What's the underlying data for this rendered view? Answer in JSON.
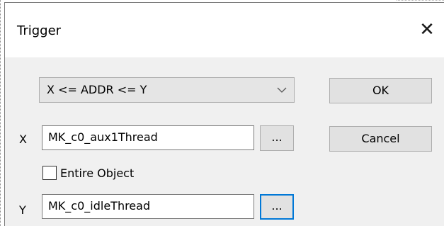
{
  "dialog": {
    "title": "Trigger",
    "close_glyph": "✕",
    "close_icon": "close-icon"
  },
  "condition": {
    "selected": "X <= ADDR <= Y",
    "arrow_icon": "chevron-down-icon"
  },
  "buttons": {
    "ok": "OK",
    "cancel": "Cancel",
    "browse": "..."
  },
  "fields": {
    "x_label": "X",
    "x_value": "MK_c0_aux1Thread",
    "y_label": "Y",
    "y_value": "MK_c0_idleThread"
  },
  "entire_object": {
    "label": "Entire Object",
    "checked": false
  }
}
